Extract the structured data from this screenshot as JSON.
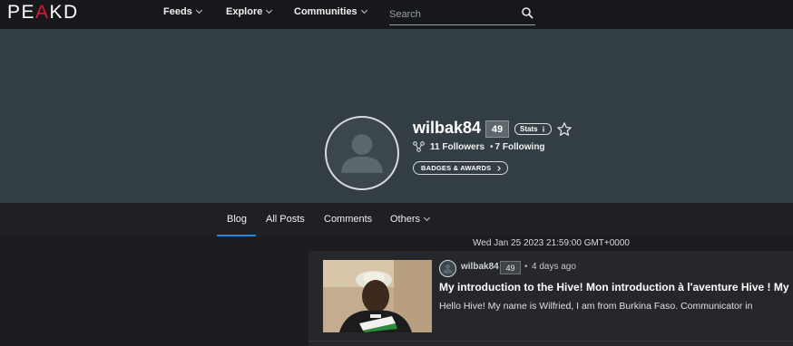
{
  "app": {
    "logo_left": "PE",
    "logo_mid": "A",
    "logo_right": "KD"
  },
  "nav": {
    "items": [
      {
        "label": "Feeds"
      },
      {
        "label": "Explore"
      },
      {
        "label": "Communities"
      }
    ],
    "search": {
      "placeholder": "Search",
      "icon": "search-icon"
    }
  },
  "profile": {
    "username": "wilbak84",
    "reputation": "49",
    "stats_label": "Stats",
    "followers": "11 Followers",
    "separator": "•",
    "following": "7 Following",
    "badges_label": "BADGES & AWARDS"
  },
  "tabs": [
    {
      "label": "Blog",
      "active": true
    },
    {
      "label": "All Posts"
    },
    {
      "label": "Comments"
    },
    {
      "label": "Others"
    }
  ],
  "tooltip": "Wed Jan 25 2023 21:59:00 GMT+0000",
  "post": {
    "author": "wilbak84",
    "reputation": "49",
    "dot": "•",
    "time_ago": "4 days ago",
    "title": "My introduction to the Hive! Mon introduction à l'aventure Hive ! My",
    "excerpt": "Hello Hive! My name is Wilfried, I am from Burkina Faso. Communicator in"
  },
  "colors": {
    "accent": "#e31337",
    "active_tab": "#1e88e5",
    "cover": "#323e44"
  }
}
